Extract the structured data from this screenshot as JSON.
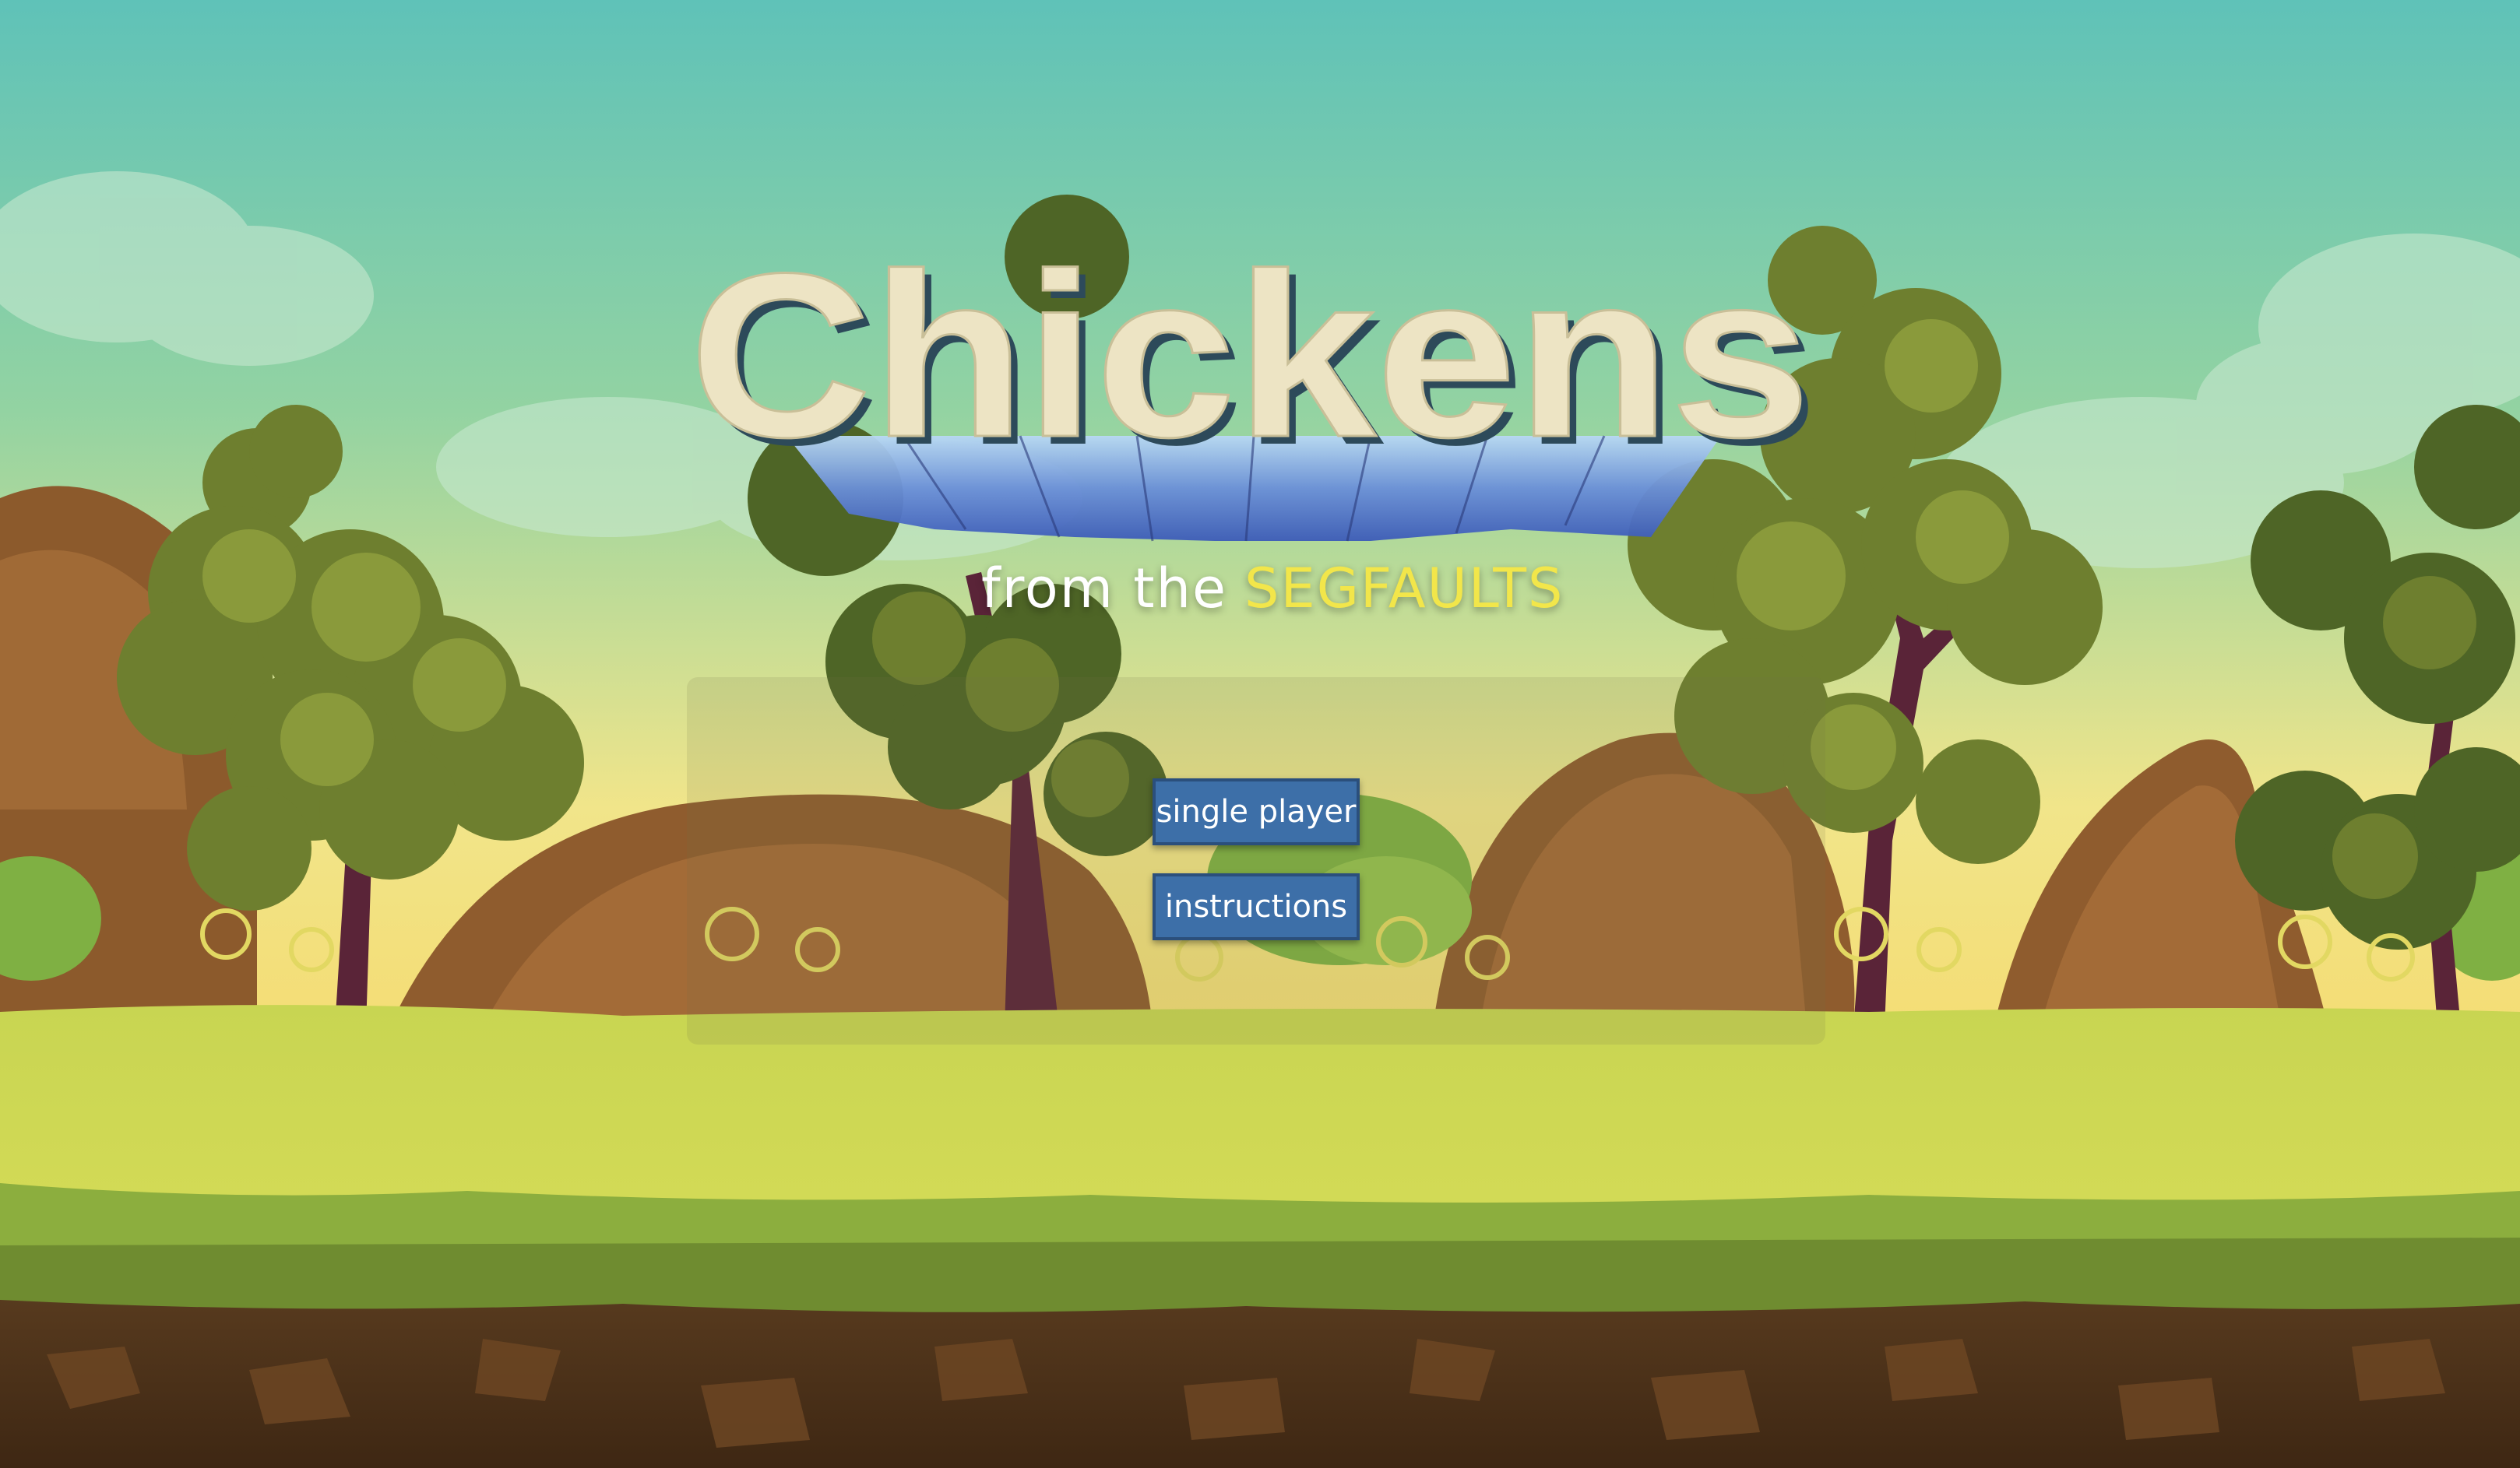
{
  "title": "Chickens",
  "subtitle": {
    "prefix": "from the",
    "team": "SEGFAULTS"
  },
  "menu": {
    "single_player_label": "single player",
    "instructions_label": "instructions"
  },
  "colors": {
    "sky_top": "#5fc2b8",
    "sky_bottom": "#f4e27a",
    "subtitle_team": "#f2e64a",
    "button_fill": "#3d6fa8",
    "button_border": "#2b4f7c",
    "grass": "#c9d650",
    "dirt": "#4a3018"
  },
  "icons": [
    "tree-icon",
    "rock-icon",
    "bush-icon",
    "cloud-icon",
    "swirl-plant-icon"
  ]
}
